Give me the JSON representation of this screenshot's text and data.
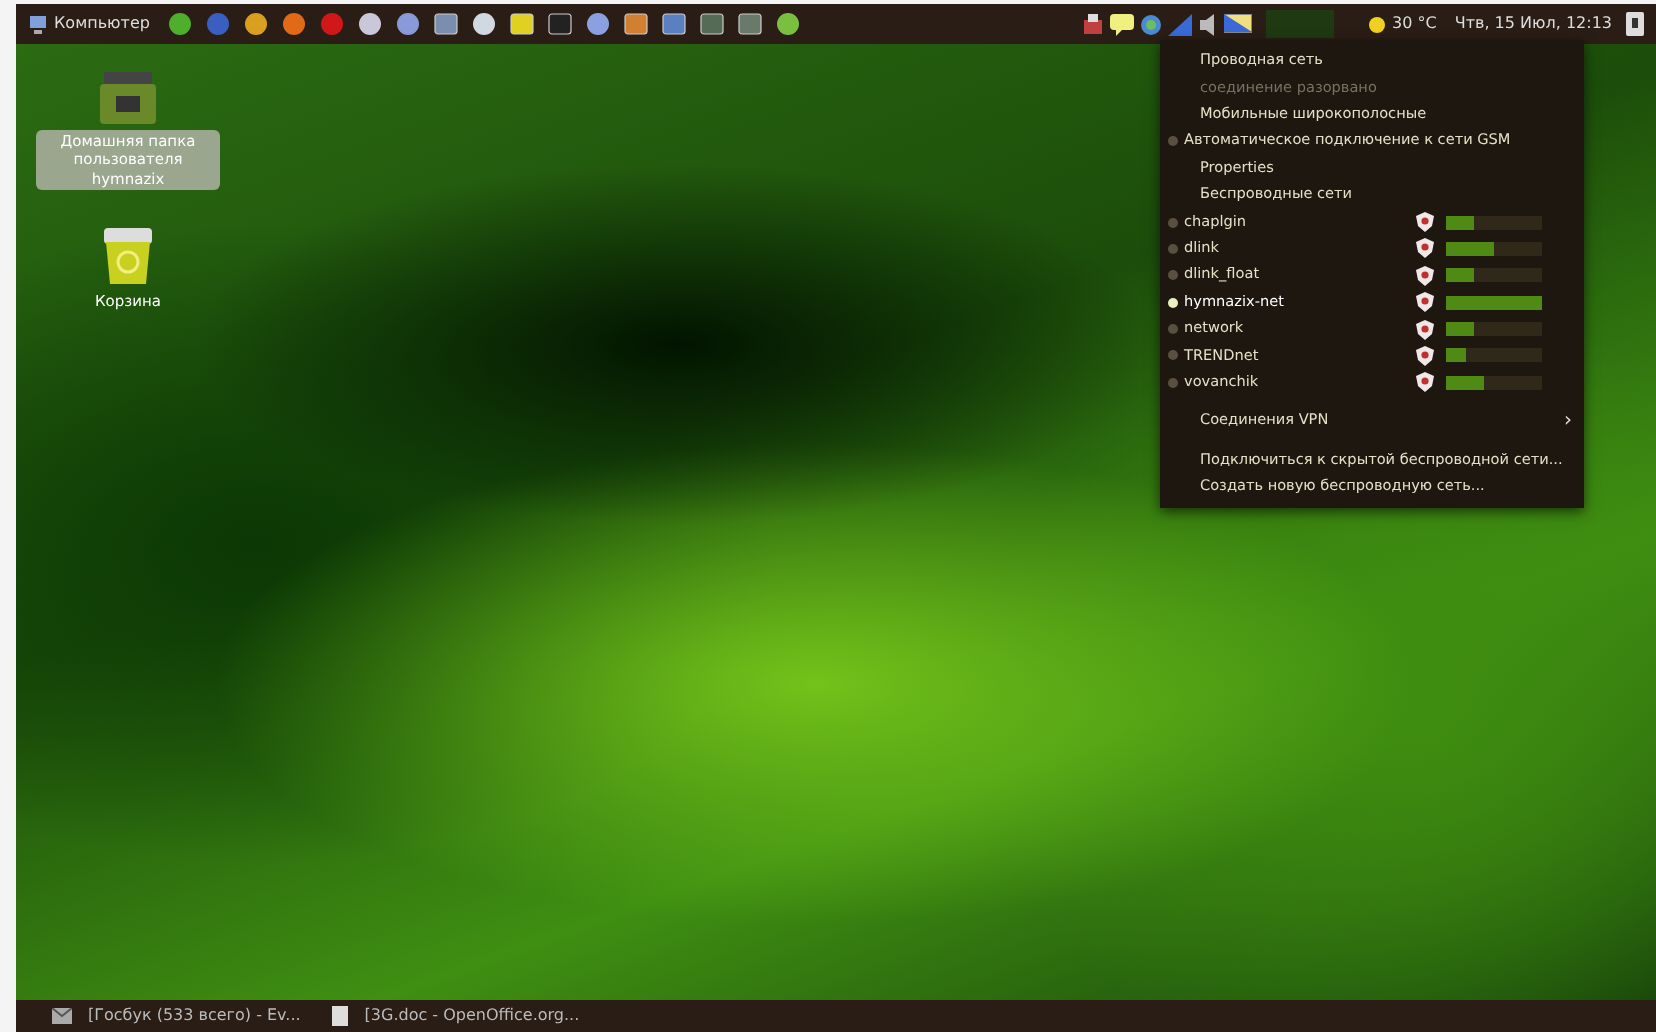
{
  "top_panel": {
    "menu_label": "Компьютер",
    "weather": "30 °C",
    "clock": "Чтв, 15 Июл, 12:13"
  },
  "desktop_icons": [
    {
      "kind": "folder",
      "label": "Домашняя папка пользователя hymnazix",
      "selected": true
    },
    {
      "kind": "trash",
      "label": "Корзина",
      "selected": false
    }
  ],
  "network_menu": [
    {
      "kind": "item",
      "text": "Проводная сеть",
      "disabled": false
    },
    {
      "kind": "item",
      "text": "соединение разорвано",
      "disabled": true
    },
    {
      "kind": "item",
      "text": "Мобильные широкополосные",
      "disabled": false
    },
    {
      "kind": "radio",
      "text": "Автоматическое подключение к сети GSM",
      "selected": false
    },
    {
      "kind": "item",
      "text": "Properties",
      "disabled": false
    },
    {
      "kind": "item",
      "text": "Беспроводные сети",
      "disabled": false
    },
    {
      "kind": "network",
      "text": "chaplgin",
      "selected": false,
      "level": 0.3
    },
    {
      "kind": "network",
      "text": "dlink",
      "selected": false,
      "level": 0.5
    },
    {
      "kind": "network",
      "text": "dlink_float",
      "selected": false,
      "level": 0.3
    },
    {
      "kind": "network",
      "text": "hymnazix-net",
      "selected": true,
      "level": 1
    },
    {
      "kind": "network",
      "text": "network",
      "selected": false,
      "level": 0.3
    },
    {
      "kind": "network",
      "text": "TRENDnet",
      "selected": false,
      "level": 0.2
    },
    {
      "kind": "network",
      "text": "vovanchik",
      "selected": false,
      "level": 0.4
    },
    {
      "kind": "gap"
    },
    {
      "kind": "submenu",
      "text": "Соединения VPN",
      "arrow": "›"
    },
    {
      "kind": "gap"
    },
    {
      "kind": "item",
      "text": "Подключиться к скрытой беспроводной сети...",
      "disabled": false
    },
    {
      "kind": "item",
      "text": "Создать новую беспроводную сеть...",
      "disabled": false
    }
  ],
  "taskbar": [
    {
      "kind": "mail",
      "title": "[Госбук (533 всего) - Ev..."
    },
    {
      "kind": "document",
      "title": "[3G.doc - OpenOffice.org..."
    }
  ]
}
